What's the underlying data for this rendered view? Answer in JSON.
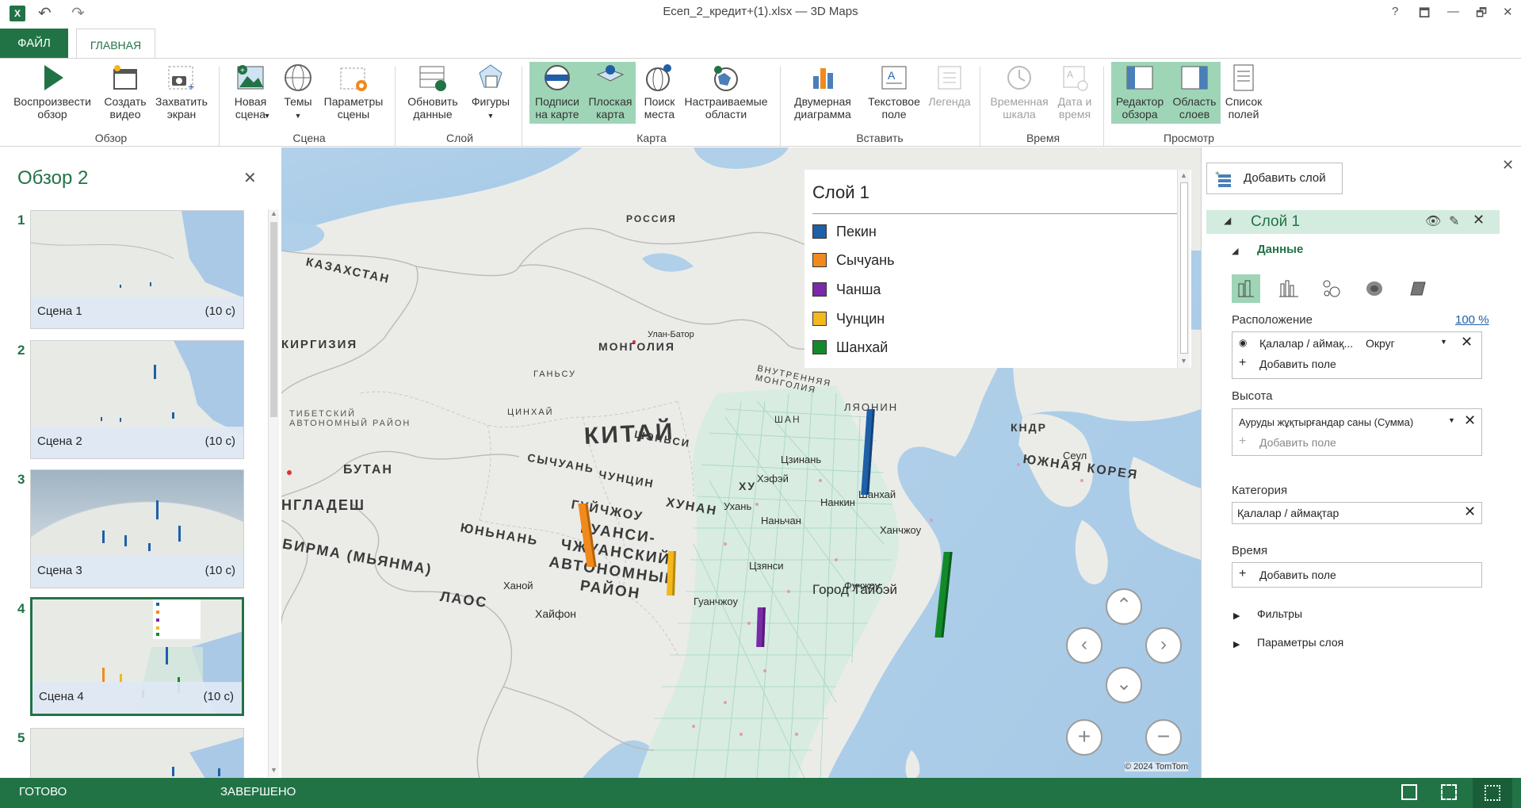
{
  "window": {
    "title": "Есеп_2_кредит+(1).xlsx — 3D Maps",
    "help": "?",
    "restore_down": "🗖",
    "minimize": "—",
    "maximize": "🗗",
    "close": "✕"
  },
  "tabs": {
    "file": "ФАЙЛ",
    "home": "ГЛАВНАЯ"
  },
  "ribbon": {
    "play_tour": "Воспроизвести обзор",
    "create_video": "Создать видео",
    "capture_screen": "Захватить экран",
    "group_tour": "Обзор",
    "new_scene": "Новая сцена",
    "themes": "Темы",
    "scene_options": "Параметры сцены",
    "group_scene": "Сцена",
    "refresh_data": "Обновить данные",
    "shapes": "Фигуры",
    "group_layer": "Слой",
    "map_labels": "Подписи на карте",
    "flat_map": "Плоская карта",
    "find_location": "Поиск места",
    "custom_regions": "Настраиваемые области",
    "group_map": "Карта",
    "chart_2d": "Двумерная диаграмма",
    "text_box": "Текстовое поле",
    "legend": "Легенда",
    "group_insert": "Вставить",
    "timeline": "Временная шкала",
    "date_time": "Дата и время",
    "group_time": "Время",
    "tour_editor": "Редактор обзора",
    "layer_pane": "Область слоев",
    "field_list": "Список полей",
    "group_view": "Просмотр"
  },
  "tour": {
    "title": "Обзор 2",
    "close": "✕",
    "scenes": [
      {
        "num": "1",
        "name": "Сцена 1",
        "duration": "(10 с)"
      },
      {
        "num": "2",
        "name": "Сцена 2",
        "duration": "(10 с)"
      },
      {
        "num": "3",
        "name": "Сцена 3",
        "duration": "(10 с)"
      },
      {
        "num": "4",
        "name": "Сцена 4",
        "duration": "(10 с)"
      },
      {
        "num": "5",
        "name": "",
        "duration": ""
      }
    ]
  },
  "map": {
    "labels": {
      "russia": "РОССИЯ",
      "kazakhstan": "КАЗАХСТАН",
      "kyrgyzstan": "КИРГИЗИЯ",
      "mongolia": "МОНГОЛИЯ",
      "ulaanbaatar": "Улан-Батор",
      "china": "КИТАЙ",
      "tibet": "ТИБЕТСКИЙ АВТОНОМНЫЙ РАЙОН",
      "bhutan": "БУТАН",
      "bangladesh": "НГЛАДЕШ",
      "burma": "БИРМА (МЬЯНМА)",
      "laos": "ЛАОС",
      "guangxi": "ГУАНСИ-ЧЖУАНСКИЙ АВТОНОМНЫЙ РАЙОН",
      "yunnan": "ЮНЬНАНЬ",
      "guizhou": "ГУЙЧЖОУ",
      "sichuan": "СЫЧУАНЬ",
      "chongqing": "ЧУНЦИН",
      "hunan": "ХУНАН",
      "shaanxi": "ШЭНЬСИ",
      "gansu": "ГАНЬСУ",
      "qinghai": "ЦИНХАЙ",
      "inner_mongolia": "ВНУТРЕННЯЯ МОНГОЛИЯ",
      "liaoning": "ЛЯОНИН",
      "kndr": "КНДР",
      "south_korea": "ЮЖНАЯ КОРЕЯ",
      "seoul": "Сеул",
      "hanoi": "Ханой",
      "haiphong": "Хайфон",
      "taipei": "Город Тайбэй",
      "hangzhou": "Ханчжоу",
      "fuzhou": "Фучжоу",
      "guangzhou": "Гуанчжоу",
      "wuhan": "Ухань",
      "nanchang": "Наньчан",
      "nanjing": "Нанкин",
      "hefei": "Хэфэй",
      "jinan": "Цзинань",
      "shan": "ШАН",
      "jiangxi": "Цзянси",
      "shanghai_lbl": "Шанхай",
      "hubei": "ХУ"
    },
    "copyright": "© 2024 TomTom",
    "nav": {
      "up": "⌃",
      "left": "‹",
      "right": "›",
      "down": "⌄",
      "zoom_in": "+",
      "zoom_out": "−"
    }
  },
  "legend": {
    "title": "Слой 1",
    "items": [
      {
        "name": "Пекин",
        "color": "#1f5fa8"
      },
      {
        "name": "Сычуань",
        "color": "#f08a1c"
      },
      {
        "name": "Чанша",
        "color": "#7a2aa8"
      },
      {
        "name": "Чунцин",
        "color": "#f2b81c"
      },
      {
        "name": "Шанхай",
        "color": "#128a2a"
      }
    ]
  },
  "layers_panel": {
    "close": "✕",
    "add_layer": "Добавить слой",
    "layer_name": "Слой 1",
    "data_section": "Данные",
    "location_label": "Расположение",
    "location_percent": "100 %",
    "location_field": "Қалалар / аймақ...",
    "location_type": "Округ",
    "add_field": "Добавить поле",
    "height_label": "Высота",
    "height_field": "Ауруды жұқтырғандар саны (Сумма)",
    "category_label": "Категория",
    "category_field": "Қалалар / аймақтар",
    "time_label": "Время",
    "filters": "Фильтры",
    "layer_options": "Параметры слоя"
  },
  "status": {
    "ready": "ГОТОВО",
    "done": "ЗАВЕРШЕНО"
  }
}
